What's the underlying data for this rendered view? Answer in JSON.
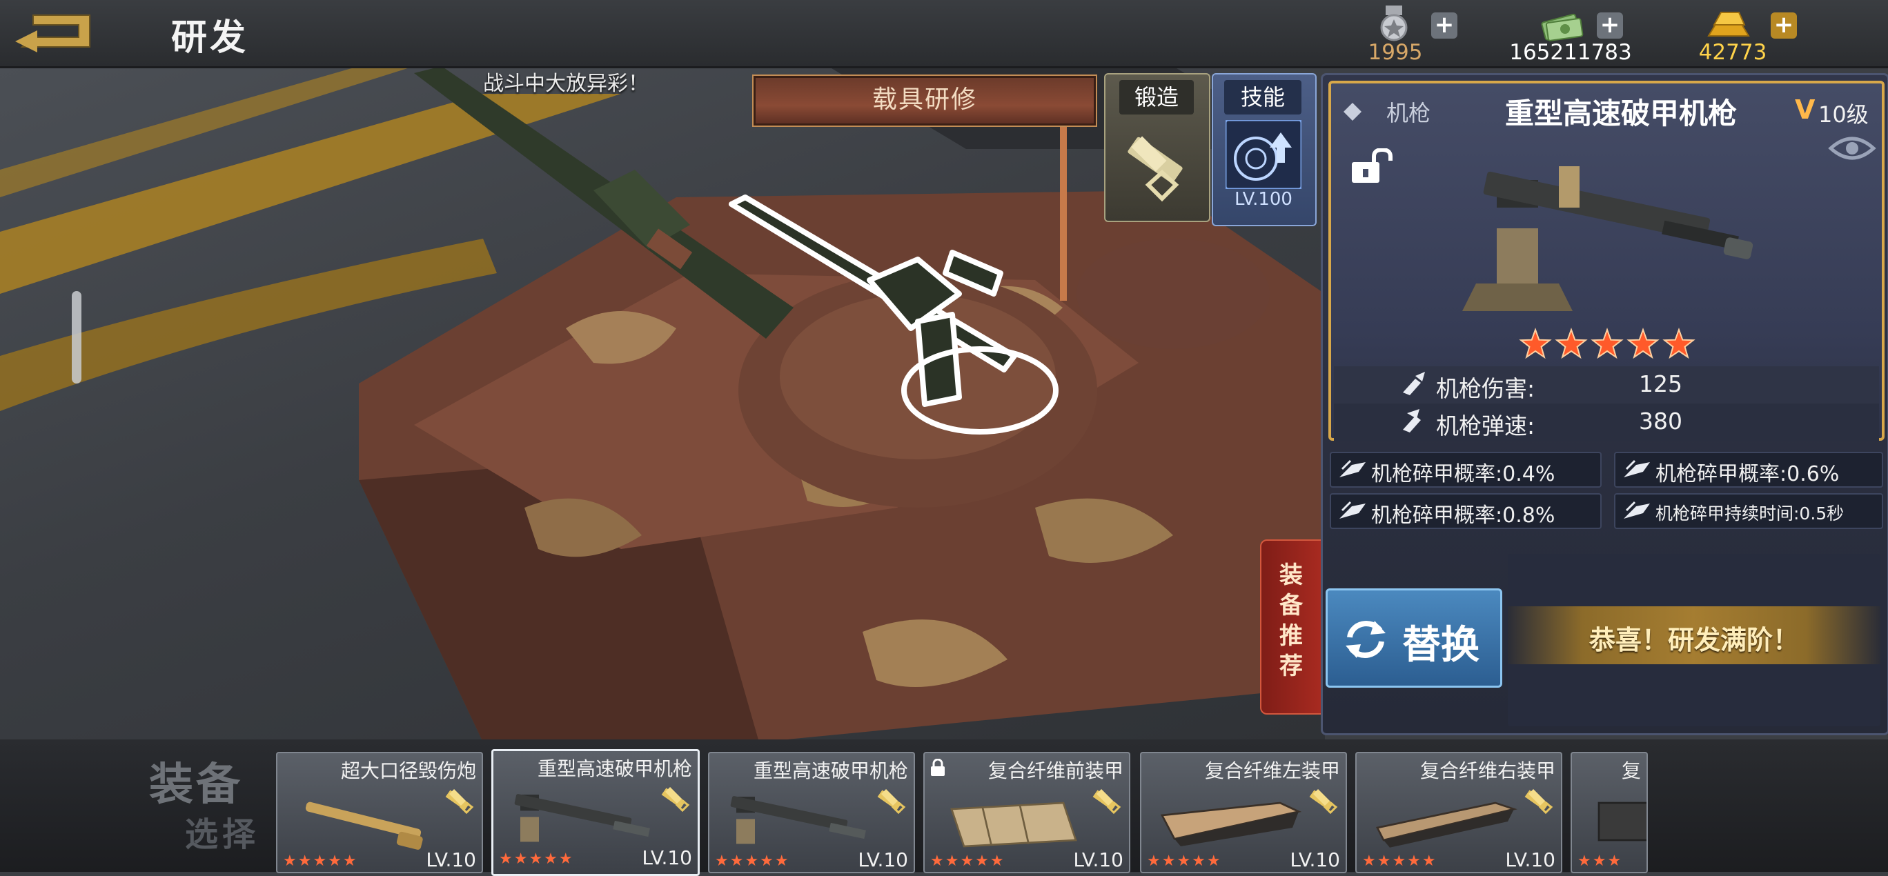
{
  "topbar": {
    "title": "研发",
    "resources": [
      {
        "name": "medal",
        "icon": "medal-icon",
        "value": "1995",
        "color": "#d8a868"
      },
      {
        "name": "cash",
        "icon": "cash-icon",
        "value": "165211783",
        "color": "#ffffff"
      },
      {
        "name": "gold",
        "icon": "gold-bars-icon",
        "value": "42773",
        "color": "#ffd34a"
      }
    ],
    "plus_symbol": "+"
  },
  "scene": {
    "battle_note": "战斗中大放异彩！",
    "vehicle_tab": "载具研修",
    "forge_label": "锻造",
    "skill_label": "技能",
    "skill_level": "LV.100",
    "recommend_label": "装备推荐"
  },
  "weapon": {
    "type": "机枪",
    "name": "重型高速破甲机枪",
    "vip_mark": "V",
    "level": "10级",
    "stars": 5,
    "stats": [
      {
        "label": "机枪伤害:",
        "value": "125"
      },
      {
        "label": "机枪弹速:",
        "value": "380"
      }
    ],
    "bonuses": [
      "机枪碎甲概率:0.4%",
      "机枪碎甲概率:0.6%",
      "机枪碎甲概率:0.8%",
      "机枪碎甲持续时间:0.5秒"
    ]
  },
  "actions": {
    "replace_label": "替换",
    "maxed_text": "恭喜！研发满阶！"
  },
  "equipment": {
    "title": "装备",
    "subtitle": "选择",
    "slots": [
      {
        "name": "超大口径毁伤炮",
        "stars": "★★★★★",
        "level": "LV.10",
        "art": "cannon",
        "locked": false,
        "selected": false
      },
      {
        "name": "重型高速破甲机枪",
        "stars": "★★★★★",
        "level": "LV.10",
        "art": "machinegun",
        "locked": false,
        "selected": true
      },
      {
        "name": "重型高速破甲机枪",
        "stars": "★★★★★",
        "level": "LV.10",
        "art": "machinegun",
        "locked": false,
        "selected": false
      },
      {
        "name": "复合纤维前装甲",
        "stars": "★★★★★",
        "level": "LV.10",
        "art": "front-armor",
        "locked": true,
        "selected": false
      },
      {
        "name": "复合纤维左装甲",
        "stars": "★★★★★",
        "level": "LV.10",
        "art": "left-armor",
        "locked": false,
        "selected": false
      },
      {
        "name": "复合纤维右装甲",
        "stars": "★★★★★",
        "level": "LV.10",
        "art": "right-armor",
        "locked": false,
        "selected": false
      },
      {
        "name": "复",
        "stars": "★★★",
        "level": "",
        "art": "armor",
        "locked": false,
        "selected": false
      }
    ]
  }
}
